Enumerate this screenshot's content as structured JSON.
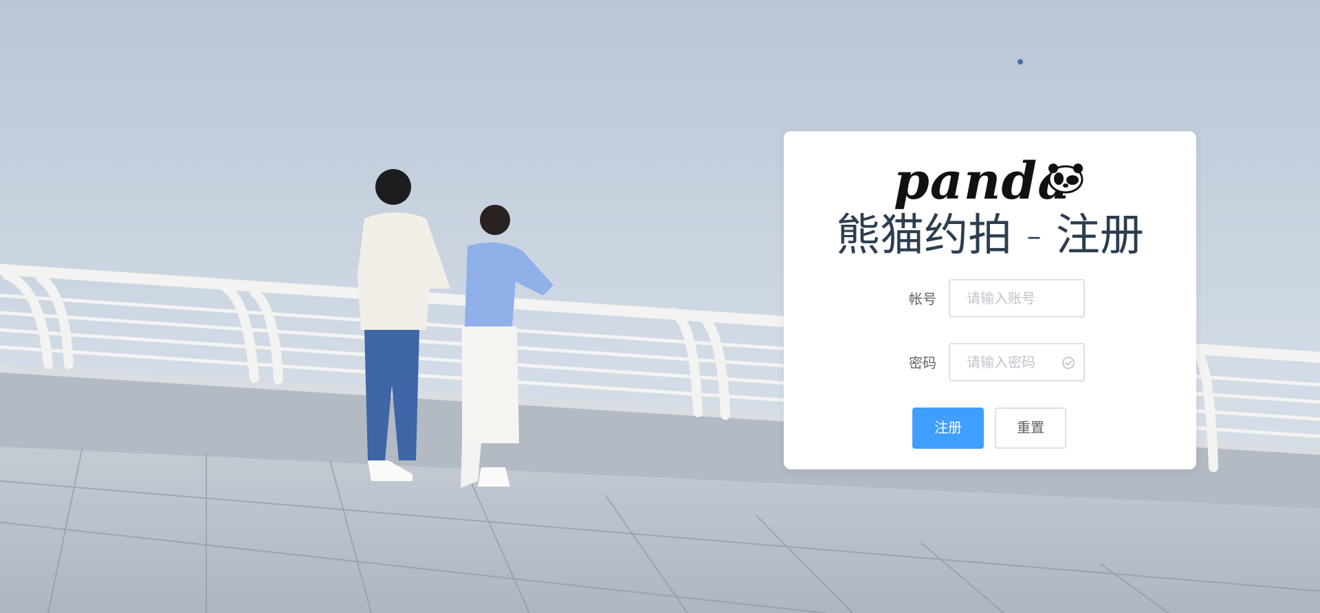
{
  "brand": {
    "logo_text": "panda",
    "logo_icon": "panda-face-icon"
  },
  "page": {
    "title": "熊猫约拍 - 注册"
  },
  "form": {
    "account": {
      "label": "帐号",
      "placeholder": "请输入账号",
      "value": ""
    },
    "password": {
      "label": "密码",
      "placeholder": "请输入密码",
      "value": "",
      "status_icon": "check-circle-icon"
    }
  },
  "actions": {
    "register_label": "注册",
    "reset_label": "重置"
  },
  "colors": {
    "primary": "#409eff",
    "title": "#2c3e50",
    "label": "#606266",
    "border": "#dcdfe6"
  }
}
